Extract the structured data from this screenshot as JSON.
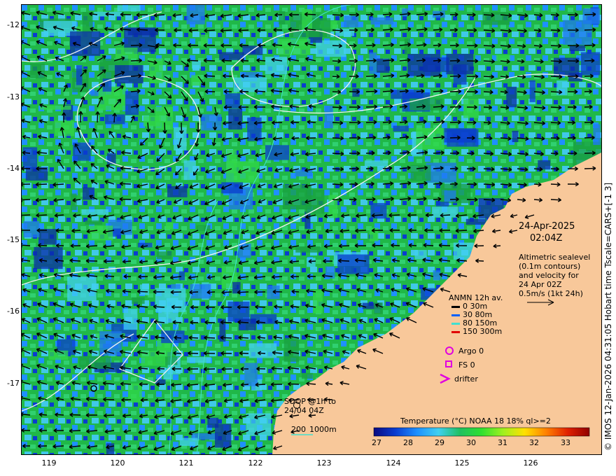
{
  "colors": {
    "land": "#f8c89a",
    "arrow": "#000000",
    "contour": "#f2f2f2",
    "isobath": "#40e0d0",
    "argo": "#e000e0",
    "fs": "#e000e0",
    "drifter": "#e000e0"
  },
  "axes": {
    "x_ticks": [
      "119",
      "120",
      "121",
      "122",
      "123",
      "124",
      "125",
      "126"
    ],
    "y_ticks": [
      "-12",
      "-13",
      "-14",
      "-15",
      "-16",
      "-17"
    ]
  },
  "header": {
    "date": "24-Apr-2025",
    "time": "02:04Z"
  },
  "info": {
    "line1": "Altimetric sealevel",
    "line2": "(0.1m contours)",
    "line3": "and velocity for",
    "line4": "24 Apr 02Z",
    "line5": "0.5m/s (1kt 24h)"
  },
  "anmn": {
    "title": "ANMN 12h av.",
    "items": [
      {
        "label": "0 30m",
        "color": "#000000"
      },
      {
        "label": "30 80m",
        "color": "#0060ff"
      },
      {
        "label": "80 150m",
        "color": "#40e0d0"
      },
      {
        "label": "150 300m",
        "color": "#e00000"
      }
    ]
  },
  "symbols": {
    "argo": "Argo 0",
    "fs": "FS 0",
    "drifter": "drifter"
  },
  "soop": {
    "line1": "SOOP @1h to",
    "line2": "24/04 04Z"
  },
  "isobath_legend": {
    "a": "200",
    "b": "1000m"
  },
  "colorbar": {
    "title": "Temperature (°C) NOAA 18 18% ql>=2",
    "ticks": [
      "27",
      "28",
      "29",
      "30",
      "31",
      "32",
      "33"
    ],
    "stops": [
      "#0a0a80",
      "#0a3cd0",
      "#1e90ff",
      "#40d0f0",
      "#20c060",
      "#30e030",
      "#a0f020",
      "#ffe000",
      "#ff8000",
      "#e02000",
      "#900000"
    ]
  },
  "credit": "© IMOS 12-Jan-2026 04:31:05 Hobart time Tscale=CARS+[-1 3]"
}
